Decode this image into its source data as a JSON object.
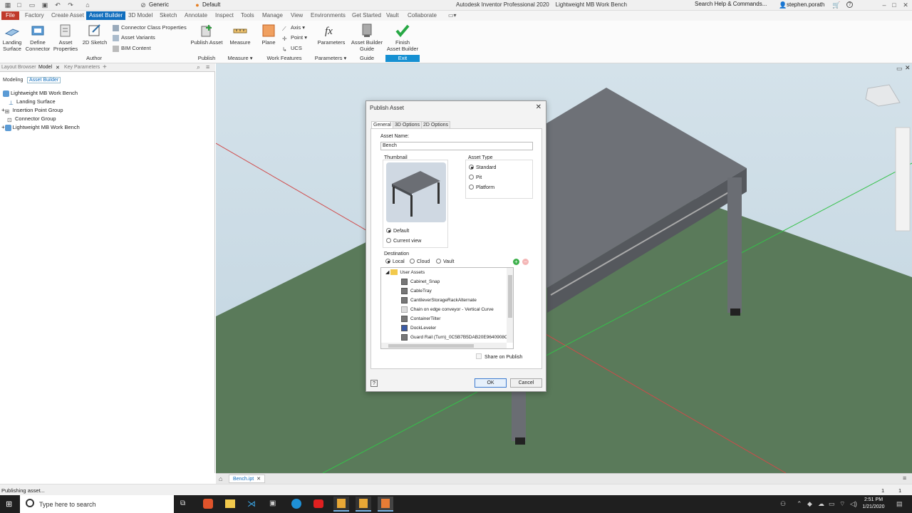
{
  "titlebar": {
    "app_title": "Autodesk Inventor Professional 2020",
    "doc_title": "Lightweight MB Work Bench",
    "style_value": "Generic",
    "appearance_value": "Default",
    "search_placeholder": "Search Help & Commands...",
    "user_name": "stephen.porath"
  },
  "menu": [
    "File",
    "Factory",
    "Create Asset",
    "Asset Builder",
    "3D Model",
    "Sketch",
    "Annotate",
    "Inspect",
    "Tools",
    "Manage",
    "View",
    "Environments",
    "Get Started",
    "Vault",
    "Collaborate"
  ],
  "ribbon": {
    "landing_surface": "Landing\nSurface",
    "define_connector": "Define\nConnector",
    "asset_properties": "Asset\nProperties",
    "sketch_2d": "2D Sketch",
    "connector_class_properties": "Connector Class Properties",
    "asset_variants": "Asset Variants",
    "bim_content": "BIM Content",
    "publish_asset": "Publish Asset",
    "measure": "Measure",
    "plane": "Plane",
    "axis": "Axis",
    "point": "Point",
    "ucs": "UCS",
    "parameters": "Parameters",
    "asset_builder_guide": "Asset Builder\nGuide",
    "finish_asset_builder": "Finish\nAsset Builder",
    "groups": {
      "author": "Author",
      "publish": "Publish",
      "measure": "Measure",
      "work_features": "Work Features",
      "parameters": "Parameters",
      "guide": "Guide",
      "exit": "Exit"
    }
  },
  "browser": {
    "tabs": [
      "Layout Browser",
      "Model",
      "Key Parameters"
    ],
    "sub_tabs": [
      "Modeling",
      "Asset Builder"
    ],
    "tree": [
      "Lightweight MB Work Bench",
      "Landing Surface",
      "Insertion Point Group",
      "Connector Group",
      "Lightweight MB Work Bench"
    ]
  },
  "dialog": {
    "title": "Publish Asset",
    "tabs": [
      "General",
      "3D Options",
      "2D Options"
    ],
    "asset_name_label": "Asset Name:",
    "asset_name_value": "Bench",
    "thumbnail_label": "Thumbnail",
    "thumbnail_options": [
      "Default",
      "Current view"
    ],
    "asset_type_label": "Asset Type",
    "asset_types": [
      "Standard",
      "Pit",
      "Platform"
    ],
    "destination_label": "Destination",
    "destinations": [
      "Local",
      "Cloud",
      "Vault"
    ],
    "list_root": "User Assets",
    "list_items": [
      "Cabinet_Snap",
      "CableTray",
      "CantileverStorageRackAlternate",
      "Chain on edge conveyor - Vertical Curve",
      "ContainerTilter",
      "DockLeveler",
      "Guard Rail (Turn)_0C5B7B5DAB20E9640908C"
    ],
    "share_on_publish": "Share on Publish",
    "ok": "OK",
    "cancel": "Cancel"
  },
  "doc_tab": "Bench.ipt",
  "status": {
    "text": "Publishing asset...",
    "n1": "1",
    "n2": "1"
  },
  "taskbar": {
    "search_placeholder": "Type here to search",
    "time": "2:51 PM",
    "date": "1/21/2020"
  },
  "colors": {
    "file_red": "#c0392b",
    "accent_blue": "#0f6dbd",
    "exit_blue": "#1690d2",
    "floor_green": "#5a7a5a",
    "bench_grey": "#6b6e74"
  }
}
